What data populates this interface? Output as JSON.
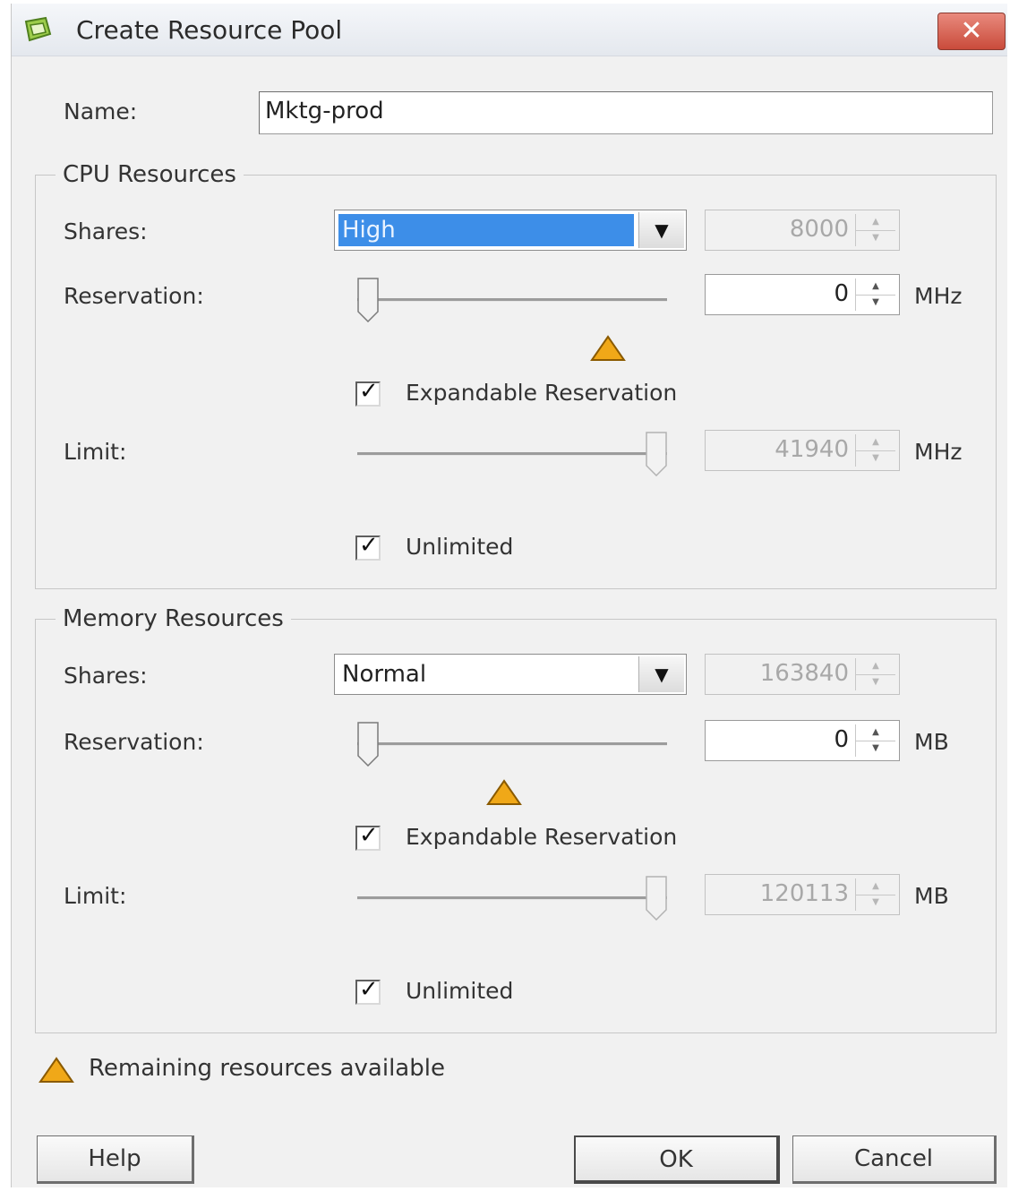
{
  "window": {
    "title": "Create Resource Pool",
    "close_icon": "close-icon",
    "app_icon": "resource-pool-icon"
  },
  "name": {
    "label": "Name:",
    "value": "Mktg-prod"
  },
  "cpu": {
    "legend": "CPU Resources",
    "shares": {
      "label": "Shares:",
      "selected": "High",
      "value": "8000"
    },
    "reservation": {
      "label": "Reservation:",
      "value": "0",
      "unit": "MHz",
      "slider_fraction": 0
    },
    "expandable": {
      "label": "Expandable Reservation",
      "checked": true
    },
    "limit": {
      "label": "Limit:",
      "value": "41940",
      "unit": "MHz",
      "slider_fraction": 1
    },
    "unlimited": {
      "label": "Unlimited",
      "checked": true
    }
  },
  "memory": {
    "legend": "Memory Resources",
    "shares": {
      "label": "Shares:",
      "selected": "Normal",
      "value": "163840"
    },
    "reservation": {
      "label": "Reservation:",
      "value": "0",
      "unit": "MB",
      "slider_fraction": 0
    },
    "expandable": {
      "label": "Expandable Reservation",
      "checked": true
    },
    "limit": {
      "label": "Limit:",
      "value": "120113",
      "unit": "MB",
      "slider_fraction": 1
    },
    "unlimited": {
      "label": "Unlimited",
      "checked": true
    }
  },
  "footer": {
    "remaining_text": "Remaining resources available",
    "help_label": "Help",
    "ok_label": "OK",
    "cancel_label": "Cancel"
  },
  "colors": {
    "warning": "#f0a818",
    "selection": "#3d8ee8",
    "close": "#c94b3b"
  }
}
